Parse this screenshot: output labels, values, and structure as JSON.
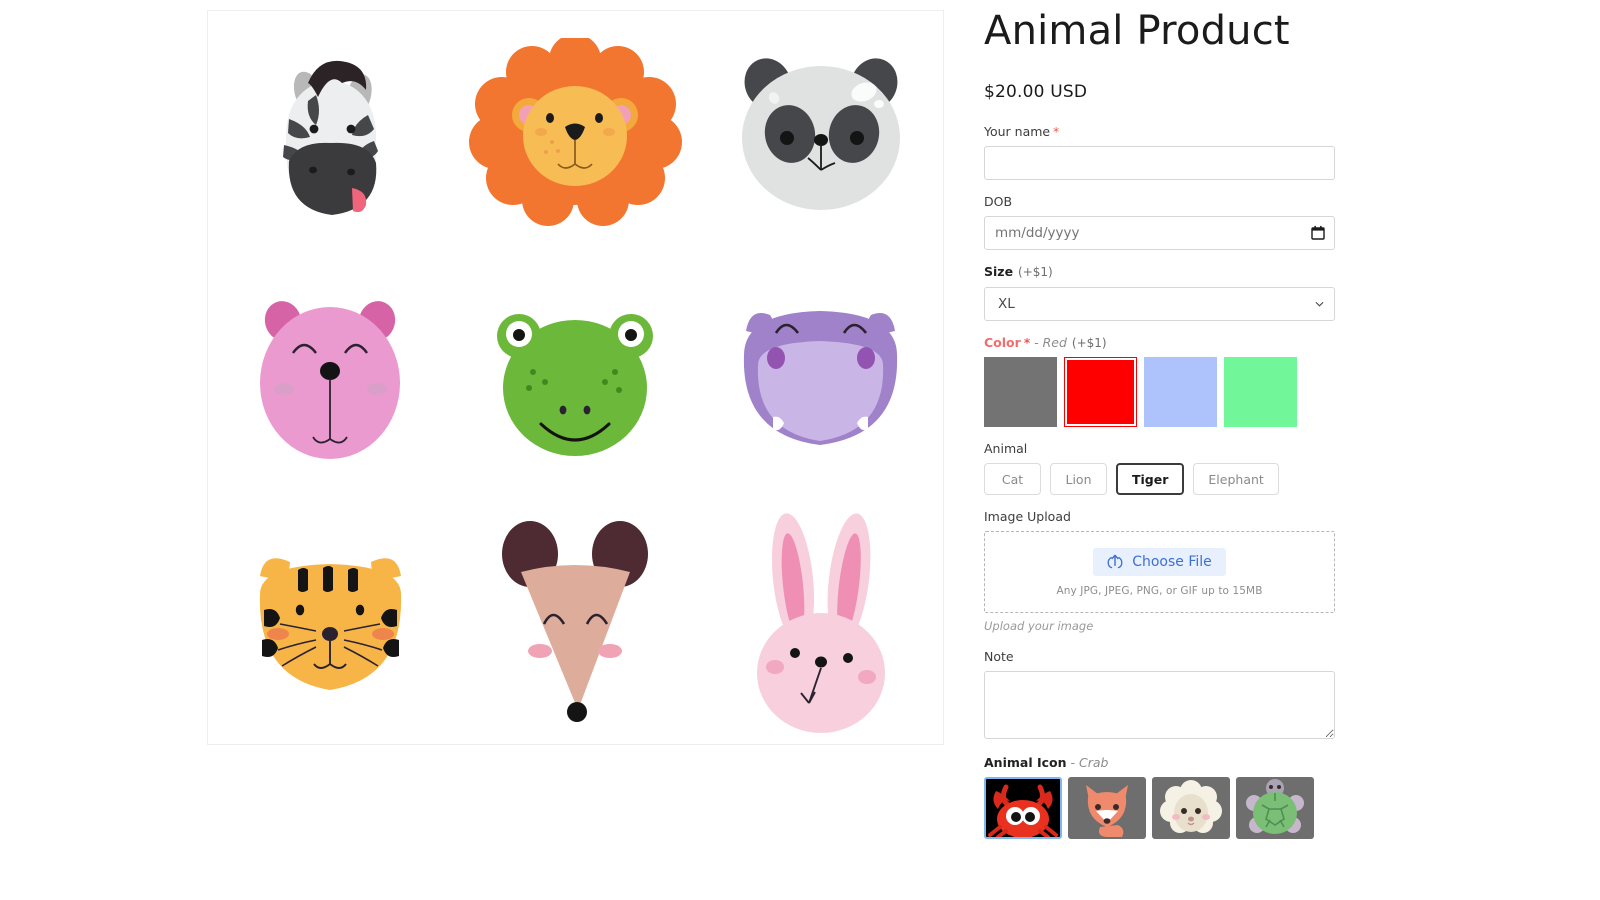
{
  "product": {
    "title": "Animal Product",
    "price": "$20.00 USD"
  },
  "gallery": {
    "name": "animal-faces-illustration",
    "animals": [
      "zebra",
      "lion",
      "panda",
      "bear",
      "frog",
      "hippo",
      "tiger",
      "mouse",
      "rabbit"
    ]
  },
  "form": {
    "name_field": {
      "label": "Your name",
      "required_marker": "*",
      "value": "",
      "placeholder": ""
    },
    "dob_field": {
      "label": "DOB",
      "placeholder": "mm/dd/yyyy",
      "value": "",
      "icon": "calendar-icon"
    },
    "size_field": {
      "label": "Size",
      "price_note": "(+$1)",
      "value": "XL",
      "options": [
        "XL"
      ],
      "icon": "chevron-down-icon"
    },
    "color_field": {
      "label": "Color",
      "required_marker": "*",
      "selected_text": "- Red",
      "price_note": "(+$1)",
      "selected_index": 1,
      "swatches": [
        {
          "name": "gray",
          "hex": "#737373"
        },
        {
          "name": "red",
          "hex": "#FF0000"
        },
        {
          "name": "light-blue",
          "hex": "#AEC2FC"
        },
        {
          "name": "light-green",
          "hex": "#72F69A"
        }
      ]
    },
    "animal_field": {
      "label": "Animal",
      "selected_index": 2,
      "options": [
        "Cat",
        "Lion",
        "Tiger",
        "Elephant"
      ]
    },
    "upload_field": {
      "label": "Image Upload",
      "button_label": "Choose File",
      "button_icon": "upload-icon",
      "hint": "Any JPG, JPEG, PNG, or GIF up to 15MB",
      "helper": "Upload your image"
    },
    "note_field": {
      "label": "Note",
      "value": "",
      "placeholder": ""
    },
    "animal_icon_field": {
      "label": "Animal Icon",
      "selected_text": "- Crab",
      "selected_index": 0,
      "tiles": [
        {
          "name": "crab-icon"
        },
        {
          "name": "fox-icon"
        },
        {
          "name": "sheep-icon"
        },
        {
          "name": "turtle-icon"
        }
      ]
    }
  }
}
